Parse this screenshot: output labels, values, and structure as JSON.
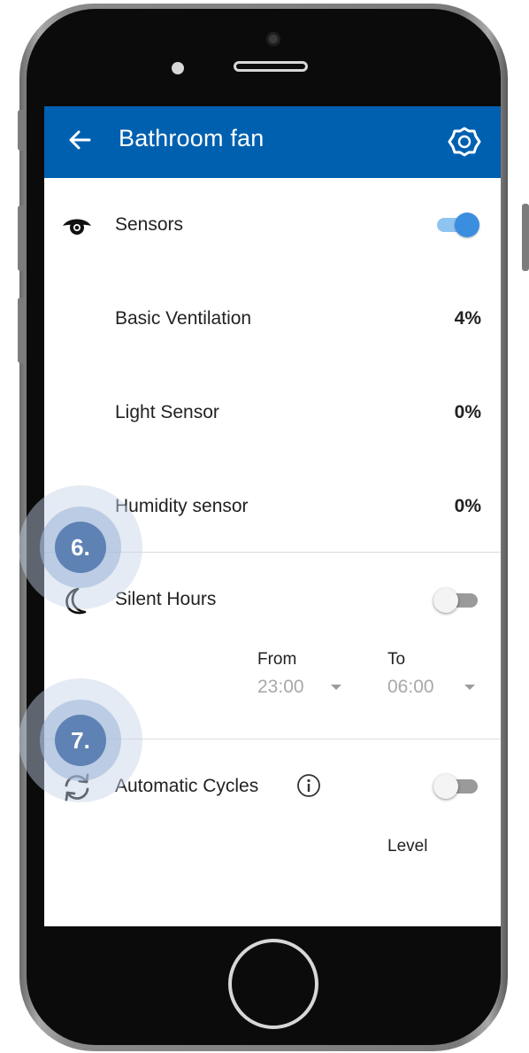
{
  "app": {
    "title": "Bathroom fan"
  },
  "colors": {
    "appbar": "#0060b0",
    "toggle_on": "#3a8ee0",
    "callout": "#5e82b4"
  },
  "icons": {
    "back": "arrow-left-icon",
    "settings": "gear-icon",
    "sensors": "eye-icon",
    "silent_hours": "moon-icon",
    "automatic_cycles": "refresh-icon",
    "info": "info-icon"
  },
  "sensors": {
    "label": "Sensors",
    "enabled": true,
    "items": [
      {
        "label": "Basic Ventilation",
        "value": "4%"
      },
      {
        "label": "Light Sensor",
        "value": "0%"
      },
      {
        "label": "Humidity sensor",
        "value": "0%"
      }
    ]
  },
  "silent_hours": {
    "label": "Silent Hours",
    "enabled": false,
    "from_label": "From",
    "from_value": "23:00",
    "to_label": "To",
    "to_value": "06:00"
  },
  "automatic_cycles": {
    "label": "Automatic Cycles",
    "enabled": false,
    "level_label": "Level"
  },
  "callouts": [
    {
      "label": "6."
    },
    {
      "label": "7."
    }
  ]
}
